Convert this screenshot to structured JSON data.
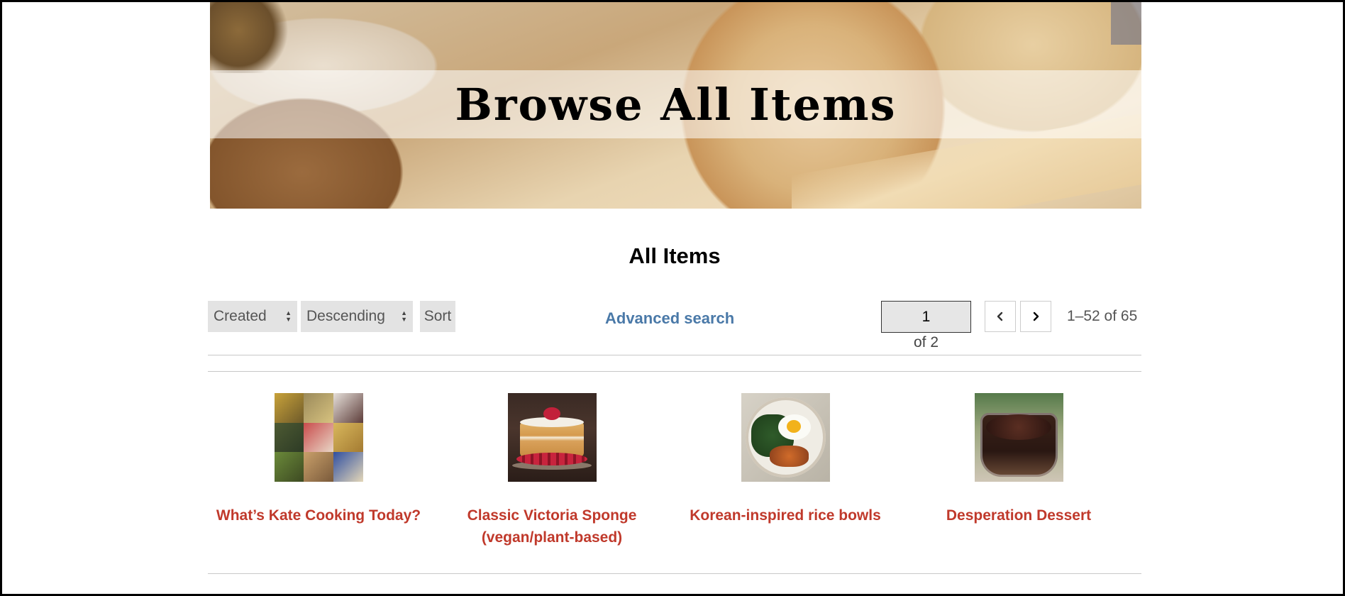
{
  "banner": {
    "title": "Browse All Items"
  },
  "section": {
    "title": "All Items"
  },
  "toolbar": {
    "sort_field": "Created",
    "sort_order": "Descending",
    "sort_label": "Sort",
    "advanced_search": "Advanced search"
  },
  "pagination": {
    "current_page": "1",
    "of_pages": "of 2",
    "range": "1–52 of 65"
  },
  "items": [
    {
      "title": "What’s Kate Cooking Today?"
    },
    {
      "title": "Classic Victoria Sponge (vegan/plant-based)"
    },
    {
      "title": "Korean-inspired rice bowls"
    },
    {
      "title": "Desperation Dessert"
    }
  ],
  "colors": {
    "link_blue": "#4a79a8",
    "item_title_red": "#c0392b",
    "control_gray": "#e3e3e3"
  }
}
